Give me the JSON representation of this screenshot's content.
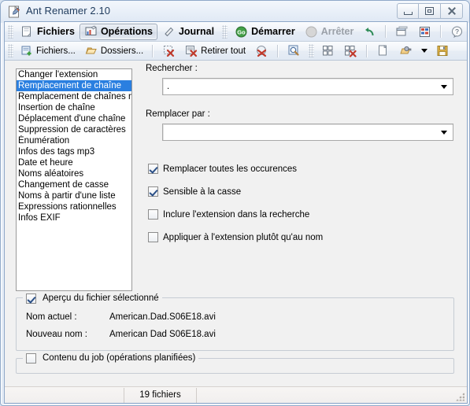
{
  "window": {
    "title": "Ant Renamer 2.10",
    "icon": "app-icon",
    "buttons": {
      "minimize": "minimize",
      "maximize": "maximize",
      "close": "close"
    }
  },
  "tabbar": {
    "items": [
      {
        "label": "Fichiers",
        "icon": "files-icon",
        "active": false
      },
      {
        "label": "Opérations",
        "icon": "operations-icon",
        "active": true
      },
      {
        "label": "Journal",
        "icon": "journal-icon",
        "active": false
      }
    ],
    "actions": [
      {
        "label": "Démarrer",
        "icon": "go-icon",
        "disabled": false
      },
      {
        "label": "Arrêter",
        "icon": "stop-icon",
        "disabled": true
      },
      {
        "label": "",
        "icon": "undo-icon",
        "disabled": false
      }
    ],
    "tools": [
      {
        "label": "",
        "icon": "window-icon"
      },
      {
        "label": "",
        "icon": "report-icon"
      },
      {
        "label": "",
        "icon": "help-icon"
      },
      {
        "label": "",
        "icon": "info-icon"
      },
      {
        "label": "",
        "icon": "exit-icon"
      }
    ]
  },
  "toolbar": {
    "items": [
      {
        "label": "Fichiers...",
        "icon": "add-files-icon"
      },
      {
        "label": "Dossiers...",
        "icon": "add-folder-icon"
      },
      {
        "label": "",
        "icon": "remove-selected-icon"
      },
      {
        "label": "Retirer tout",
        "icon": "remove-all-icon"
      },
      {
        "label": "",
        "icon": "clear-icon"
      },
      {
        "label": "",
        "icon": "preview-search-icon"
      },
      {
        "label": "",
        "icon": "grid-add-icon"
      },
      {
        "label": "",
        "icon": "grid-remove-icon"
      },
      {
        "label": "",
        "icon": "new-job-icon"
      },
      {
        "label": "",
        "icon": "open-job-icon"
      },
      {
        "label": "",
        "icon": "save-job-icon"
      }
    ]
  },
  "operations_list": {
    "selected_index": 1,
    "items": [
      "Changer l'extension",
      "Remplacement de chaîne",
      "Remplacement de chaînes mul",
      "Insertion de chaîne",
      "Déplacement d'une chaîne",
      "Suppression de caractères",
      "Énumération",
      "Infos des tags mp3",
      "Date et heure",
      "Noms aléatoires",
      "Changement de casse",
      "Noms à partir d'une liste",
      "Expressions rationnelles",
      "Infos EXIF"
    ]
  },
  "form": {
    "search_label": "Rechercher :",
    "search_value": ".",
    "replace_label": "Remplacer par :",
    "replace_value": "",
    "checkboxes": [
      {
        "label": "Remplacer toutes les occurences",
        "checked": true
      },
      {
        "label": "Sensible à la casse",
        "checked": true
      },
      {
        "label": "Inclure l'extension dans la recherche",
        "checked": false
      },
      {
        "label": "Appliquer à l'extension plutôt qu'au nom",
        "checked": false
      }
    ]
  },
  "preview": {
    "caption": "Aperçu du fichier sélectionné",
    "checked": true,
    "current_label": "Nom actuel :",
    "current_value": "American.Dad.S06E18.avi",
    "new_label": "Nouveau nom :",
    "new_value": "American Dad S06E18.avi"
  },
  "job": {
    "caption": "Contenu du job (opérations planifiées)",
    "checked": false
  },
  "statusbar": {
    "cell1": "",
    "cell2": "19 fichiers",
    "cell3": ""
  },
  "colors": {
    "selection": "#2a7fe0",
    "title_text": "#1e3a5c",
    "frame": "#8fa8c8"
  }
}
